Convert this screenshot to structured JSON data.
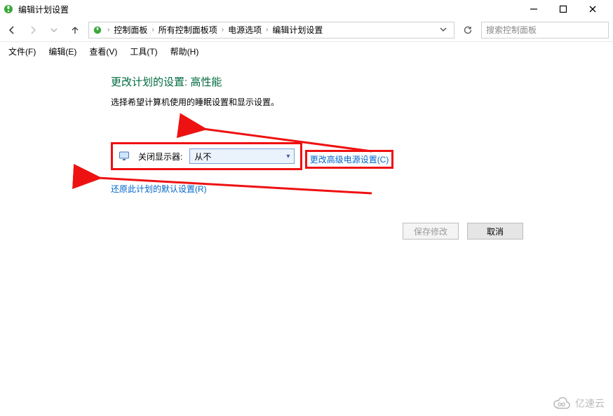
{
  "titlebar": {
    "title": "编辑计划设置"
  },
  "breadcrumb": {
    "items": [
      "控制面板",
      "所有控制面板项",
      "电源选项",
      "编辑计划设置"
    ]
  },
  "search": {
    "placeholder": "搜索控制面板"
  },
  "menu": {
    "file": "文件(F)",
    "edit": "编辑(E)",
    "view": "查看(V)",
    "tools": "工具(T)",
    "help": "帮助(H)"
  },
  "page": {
    "heading": "更改计划的设置: 高性能",
    "subtext": "选择希望计算机使用的睡眠设置和显示设置。",
    "turn_off_display_label": "关闭显示器:",
    "turn_off_display_value": "从不",
    "advanced_link": "更改高级电源设置(C)",
    "restore_link": "还原此计划的默认设置(R)"
  },
  "buttons": {
    "save": "保存修改",
    "cancel": "取消"
  },
  "watermark": {
    "label": "亿速云"
  }
}
